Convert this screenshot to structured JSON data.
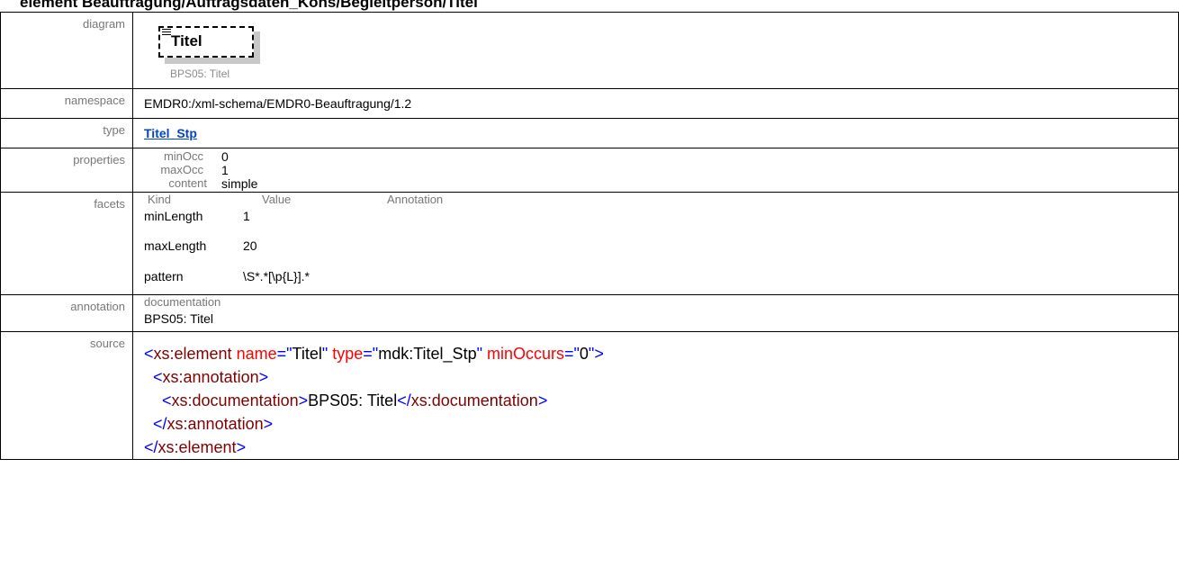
{
  "header": {
    "title": "element Beauftragung/Auftragsdaten_Kons/Begleitperson/Titel"
  },
  "rows": {
    "diagram": {
      "label": "diagram",
      "box_name": "Titel",
      "caption": "BPS05: Titel"
    },
    "namespace": {
      "label": "namespace",
      "value": "EMDR0:/xml-schema/EMDR0-Beauftragung/1.2"
    },
    "type": {
      "label": "type",
      "value": "Titel_Stp"
    },
    "properties": {
      "label": "properties",
      "items": [
        {
          "key": "minOcc",
          "value": "0"
        },
        {
          "key": "maxOcc",
          "value": "1"
        },
        {
          "key": "content",
          "value": "simple"
        }
      ]
    },
    "facets": {
      "label": "facets",
      "headers": [
        "Kind",
        "Value",
        "Annotation"
      ],
      "items": [
        {
          "kind": "minLength",
          "value": "1"
        },
        {
          "kind": "maxLength",
          "value": "20"
        },
        {
          "kind": "pattern",
          "value": "\\S*.*[\\p{L}].*"
        }
      ]
    },
    "annotation": {
      "label": "annotation",
      "heading": "documentation",
      "text": "BPS05: Titel"
    },
    "source": {
      "label": "source",
      "line1": {
        "open": "<",
        "el": "xs:element",
        "a1": "name",
        "v1": "Titel",
        "a2": "type",
        "v2": "mdk:Titel_Stp",
        "a3": "minOccurs",
        "v3": "0",
        "close": ">"
      },
      "line2": {
        "open": "<",
        "el": "xs:annotation",
        "close": ">"
      },
      "line3": {
        "open": "<",
        "el": "xs:documentation",
        "close": ">",
        "text": "BPS05: Titel",
        "endopen": "</",
        "endel": "xs:documentation",
        "endclose": ">"
      },
      "line4": {
        "open": "</",
        "el": "xs:annotation",
        "close": ">"
      },
      "line5": {
        "open": "</",
        "el": "xs:element",
        "close": ">"
      }
    }
  },
  "colors": {
    "tag": "#0000ff",
    "element_name": "#800000",
    "attribute": "#ff0000",
    "link": "#0044cc",
    "label": "#777777"
  }
}
